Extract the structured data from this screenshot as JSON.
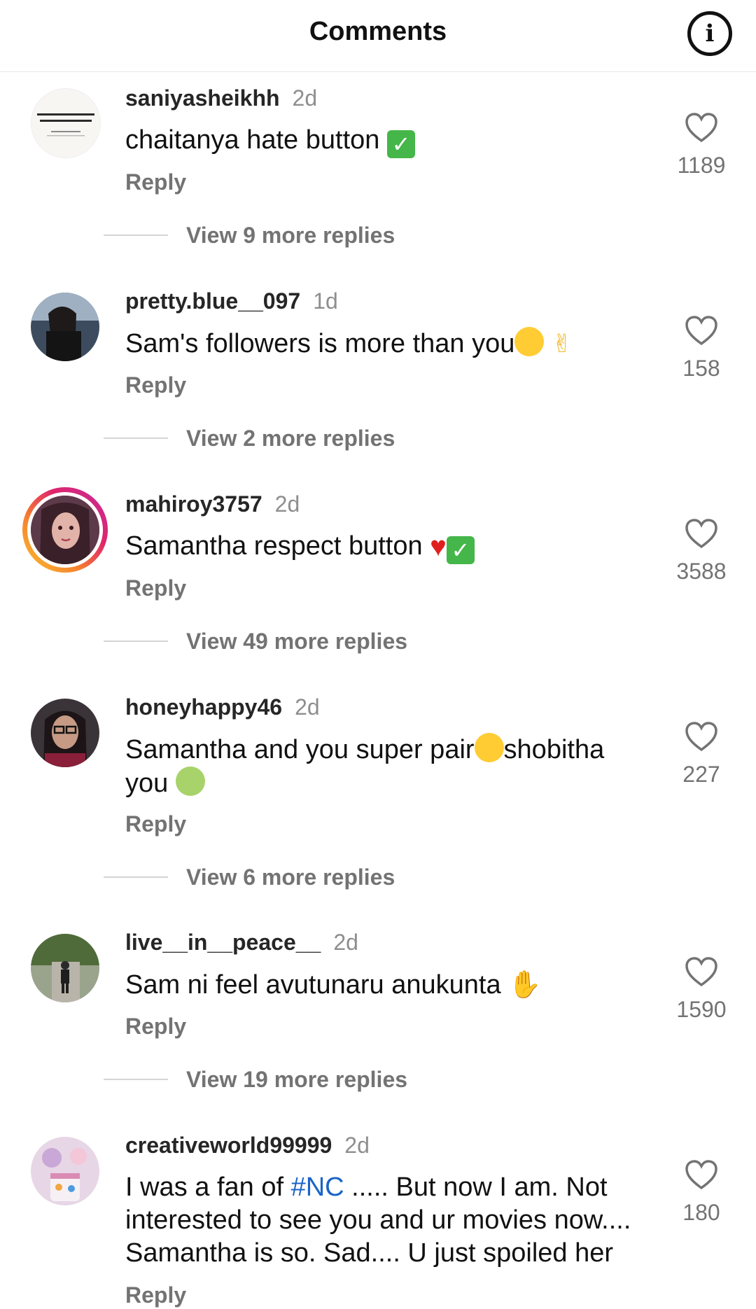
{
  "header": {
    "title": "Comments",
    "info_icon": "info-icon"
  },
  "colors": {
    "text": "#111111",
    "secondary": "#737373",
    "hashtag": "#1a64c6"
  },
  "comments": [
    {
      "username": "saniyasheikhh",
      "time": "2d",
      "text": "chaitanya hate button",
      "emojis": [
        "check-mark-emoji"
      ],
      "reply_label": "Reply",
      "view_more": "View 9 more replies",
      "likes": "1189",
      "avatar_text": "STRESS STEALS THE BEAUTY FROM LIFE"
    },
    {
      "username": "pretty.blue__097",
      "time": "1d",
      "text": "Sam's followers is more than you",
      "emojis": [
        "laughing-tears-emoji",
        "victory-hand-emoji"
      ],
      "reply_label": "Reply",
      "view_more": "View 2 more replies",
      "likes": "158"
    },
    {
      "username": "mahiroy3757",
      "time": "2d",
      "text": "Samantha respect button",
      "emojis": [
        "red-heart-emoji",
        "check-mark-emoji"
      ],
      "reply_label": "Reply",
      "view_more": "View 49 more replies",
      "likes": "3588"
    },
    {
      "username": "honeyhappy46",
      "time": "2d",
      "text_a": "Samantha and you super pair",
      "text_b": "shobitha you",
      "emojis": [
        "heart-eyes-emoji",
        "nauseated-face-emoji"
      ],
      "reply_label": "Reply",
      "view_more": "View 6 more replies",
      "likes": "227"
    },
    {
      "username": "live__in__peace__",
      "time": "2d",
      "text": "Sam ni feel avutunaru anukunta",
      "emojis": [
        "raising-hands-emoji"
      ],
      "reply_label": "Reply",
      "view_more": "View 19 more replies",
      "likes": "1590"
    },
    {
      "username": "creativeworld99999",
      "time": "2d",
      "text_a": "I was a fan of",
      "hashtag": "#NC",
      "text_b": "..... But now I am. Not interested to see you and ur movies now.... Samantha is so. Sad.... U just spoiled her",
      "reply_label": "Reply",
      "likes": "180"
    }
  ]
}
